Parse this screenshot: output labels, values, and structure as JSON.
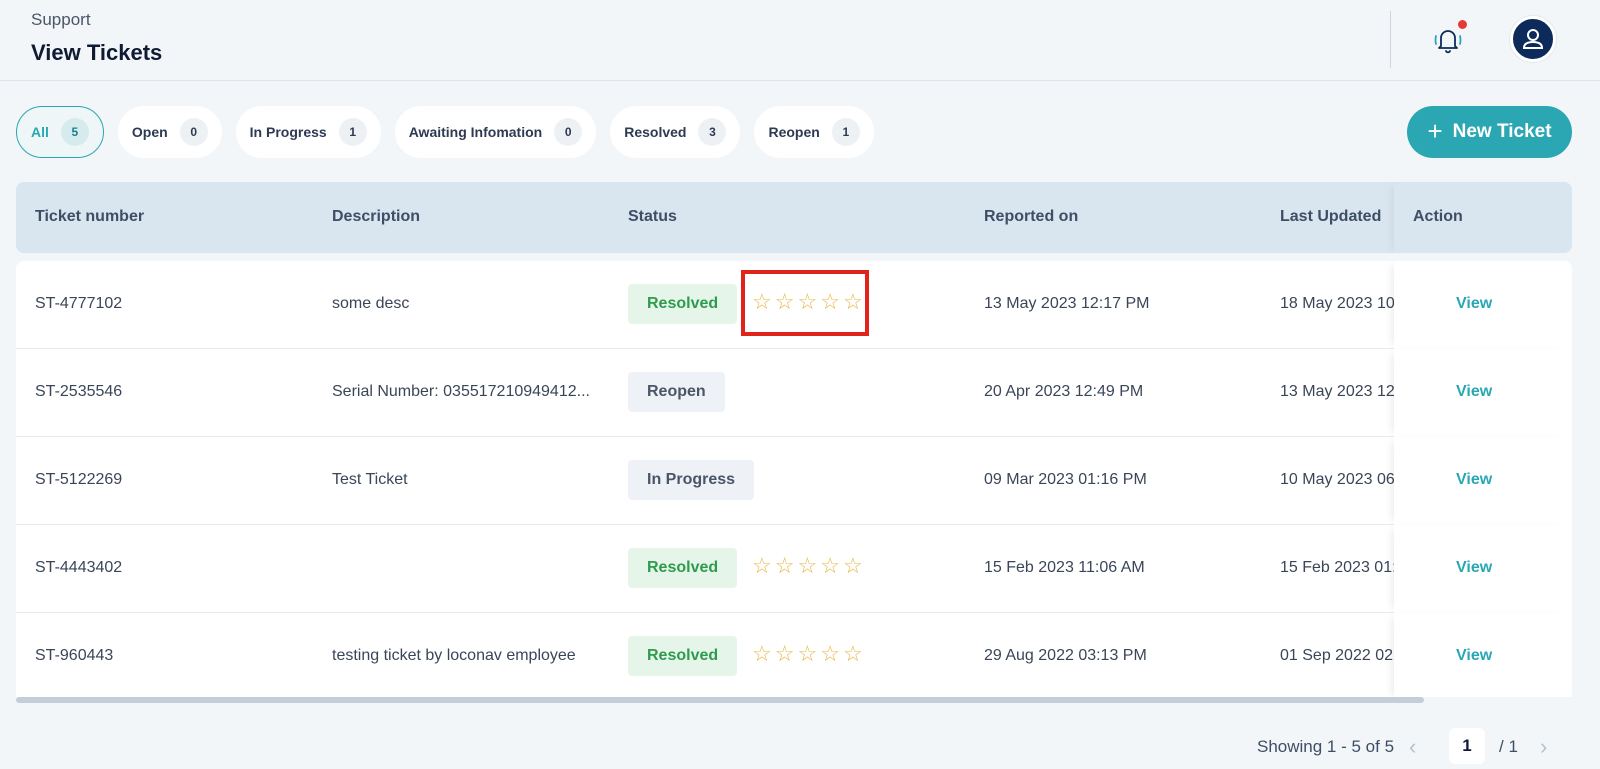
{
  "header": {
    "breadcrumb": "Support",
    "title": "View Tickets"
  },
  "filters": [
    {
      "label": "All",
      "count": "5",
      "active": true
    },
    {
      "label": "Open",
      "count": "0"
    },
    {
      "label": "In Progress",
      "count": "1"
    },
    {
      "label": "Awaiting Infomation",
      "count": "0"
    },
    {
      "label": "Resolved",
      "count": "3"
    },
    {
      "label": "Reopen",
      "count": "1"
    }
  ],
  "new_ticket_label": "New Ticket",
  "table": {
    "columns": {
      "ticket_number": "Ticket number",
      "description": "Description",
      "status": "Status",
      "reported_on": "Reported on",
      "last_updated": "Last Updated",
      "action": "Action"
    },
    "rows": [
      {
        "ticket": "ST-4777102",
        "description": "some desc",
        "status": "Resolved",
        "rating_stars": 5,
        "rating_value": 0,
        "reported": "13 May 2023 12:17 PM",
        "updated": "18 May 2023 10",
        "action": "View"
      },
      {
        "ticket": "ST-2535546",
        "description": "Serial Number: 035517210949412...",
        "status": "Reopen",
        "reported": "20 Apr 2023 12:49 PM",
        "updated": "13 May 2023 12:",
        "action": "View"
      },
      {
        "ticket": "ST-5122269",
        "description": "Test Ticket",
        "status": "In Progress",
        "reported": "09 Mar 2023 01:16 PM",
        "updated": "10 May 2023 06",
        "action": "View"
      },
      {
        "ticket": "ST-4443402",
        "description": "",
        "status": "Resolved",
        "rating_stars": 5,
        "rating_value": 0,
        "reported": "15 Feb 2023 11:06 AM",
        "updated": "15 Feb 2023 01:",
        "action": "View"
      },
      {
        "ticket": "ST-960443",
        "description": "testing ticket by loconav employee",
        "status": "Resolved",
        "rating_stars": 5,
        "rating_value": 0,
        "reported": "29 Aug 2022 03:13 PM",
        "updated": "01 Sep 2022 02",
        "action": "View"
      }
    ]
  },
  "pagination": {
    "info": "Showing 1 - 5 of 5",
    "current_page": "1",
    "total": "/ 1"
  },
  "colors": {
    "accent": "#2aa7b3",
    "resolved_bg": "#e6f5ea",
    "resolved_text": "#2e9b4d",
    "star": "#e9b949",
    "highlight": "#e0241b"
  },
  "icons": {
    "bell": "bell-icon",
    "avatar": "user-icon",
    "plus": "plus-icon",
    "star": "star-outline-icon",
    "prev": "chevron-left-icon",
    "next": "chevron-right-icon"
  }
}
